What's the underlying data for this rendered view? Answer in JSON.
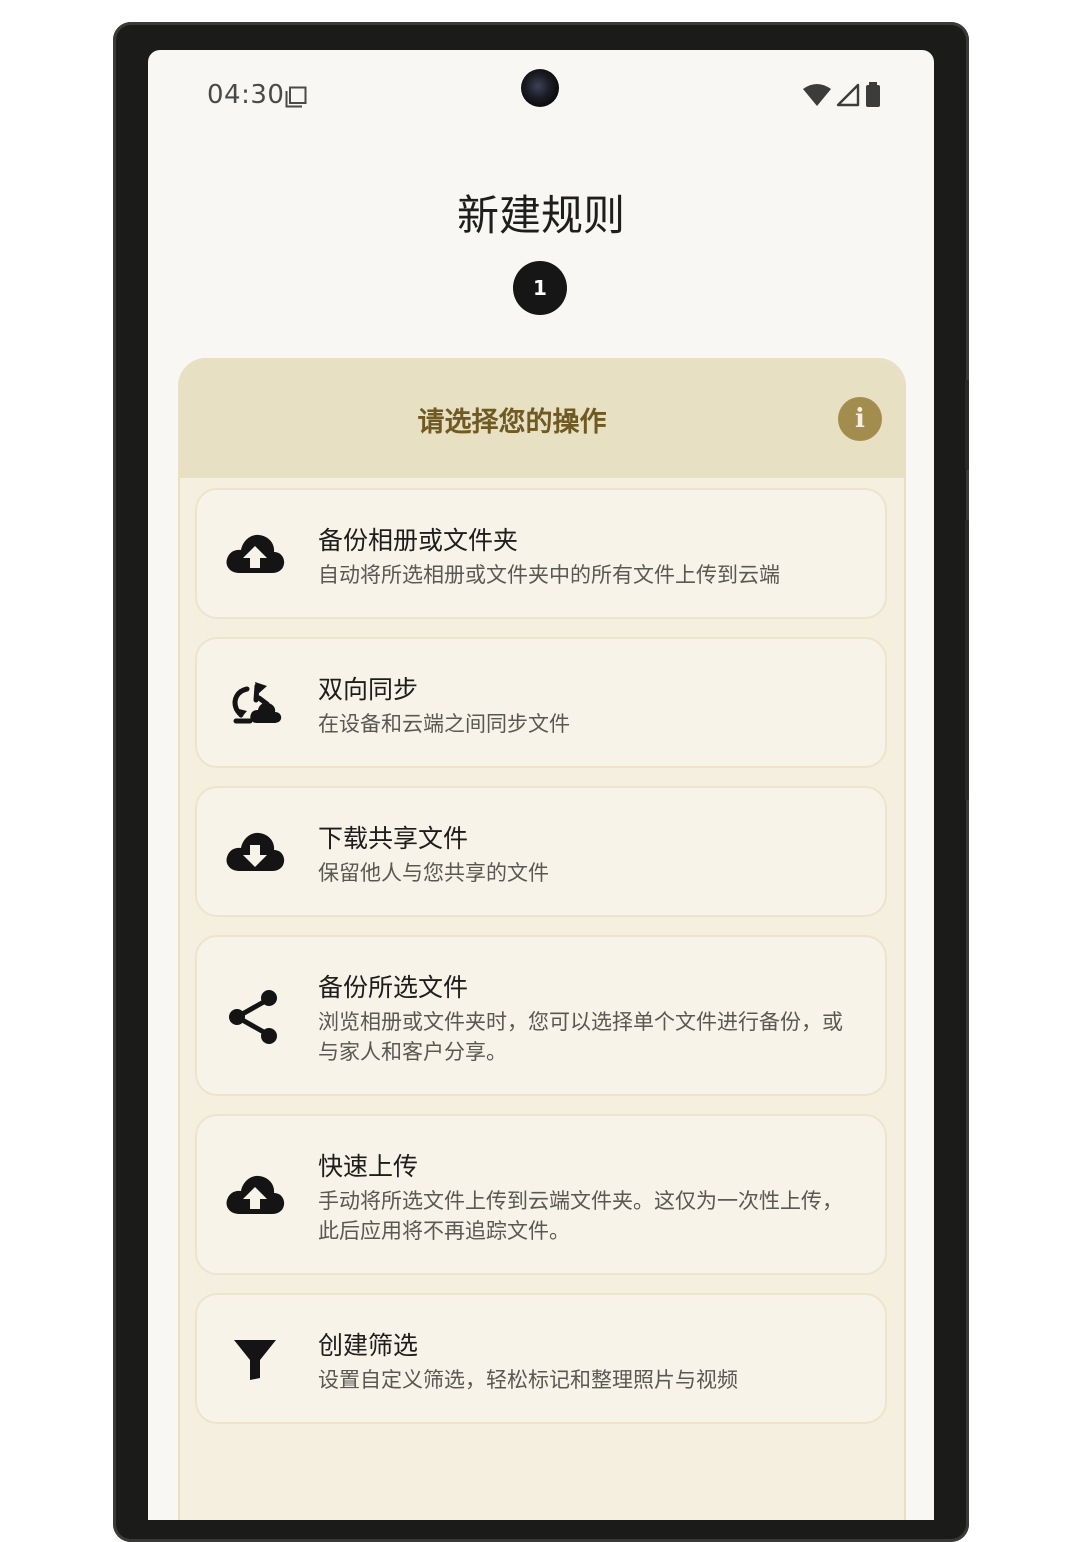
{
  "status_bar": {
    "time": "04:30"
  },
  "page": {
    "title": "新建规则",
    "step_number": "1"
  },
  "panel": {
    "header_title": "请选择您的操作",
    "info_icon_glyph": "i"
  },
  "options": [
    {
      "title": "备份相册或文件夹",
      "description": "自动将所选相册或文件夹中的所有文件上传到云端",
      "icon": "cloud-upload-icon"
    },
    {
      "title": "双向同步",
      "description": "在设备和云端之间同步文件",
      "icon": "two-way-sync-icon"
    },
    {
      "title": "下载共享文件",
      "description": "保留他人与您共享的文件",
      "icon": "cloud-download-icon"
    },
    {
      "title": "备份所选文件",
      "description": "浏览相册或文件夹时，您可以选择单个文件进行备份，或与家人和客户分享。",
      "icon": "share-icon"
    },
    {
      "title": "快速上传",
      "description": "手动将所选文件上传到云端文件夹。这仅为一次性上传，此后应用将不再追踪文件。",
      "icon": "cloud-upload-icon"
    },
    {
      "title": "创建筛选",
      "description": "设置自定义筛选，轻松标记和整理照片与视频",
      "icon": "filter-icon"
    }
  ],
  "colors": {
    "panel_background": "#f5efdf",
    "panel_header": "#e8e0c2",
    "header_text": "#6e5a22",
    "info_badge": "#a38d4e"
  }
}
